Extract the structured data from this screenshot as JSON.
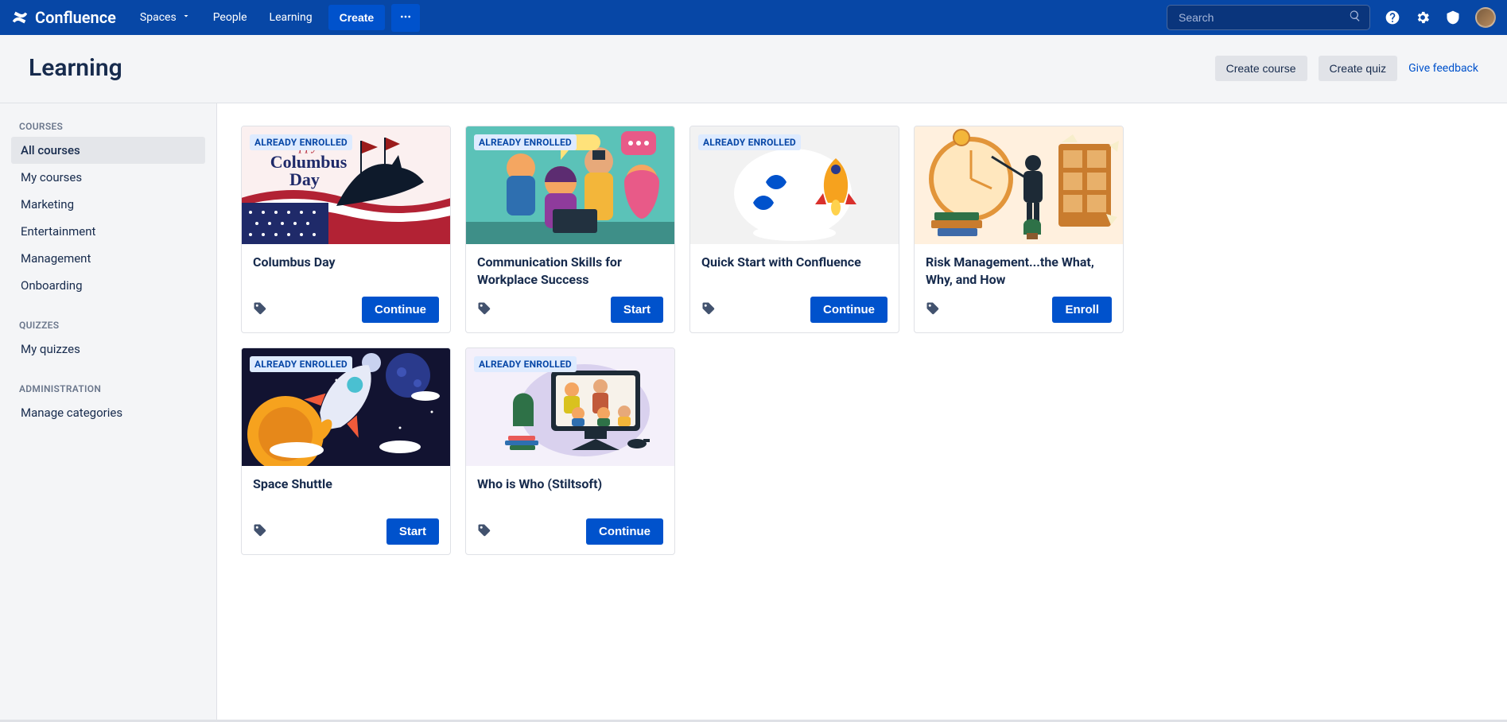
{
  "brand": "Confluence",
  "nav": {
    "spaces": "Spaces",
    "people": "People",
    "learning": "Learning",
    "create": "Create"
  },
  "search": {
    "placeholder": "Search"
  },
  "page": {
    "title": "Learning",
    "create_course": "Create course",
    "create_quiz": "Create quiz",
    "give_feedback": "Give feedback"
  },
  "sidebar": {
    "courses_h": "COURSES",
    "courses": [
      "All courses",
      "My courses",
      "Marketing",
      "Entertainment",
      "Management",
      "Onboarding"
    ],
    "quizzes_h": "QUIZZES",
    "quizzes": [
      "My quizzes"
    ],
    "admin_h": "ADMINISTRATION",
    "admin": [
      "Manage categories"
    ]
  },
  "badge_text": "ALREADY ENROLLED",
  "cards": [
    {
      "title": "Columbus Day",
      "badge": true,
      "action": "Continue",
      "bg": "#FBF0F0"
    },
    {
      "title": "Communication Skills for Workplace Success",
      "badge": true,
      "action": "Start",
      "bg": "#E8F2F2"
    },
    {
      "title": "Quick Start with Confluence",
      "badge": true,
      "action": "Continue",
      "bg": "#F2F2F2"
    },
    {
      "title": "Risk Management...the What, Why, and How",
      "badge": false,
      "action": "Enroll",
      "bg": "#FFF0DE"
    },
    {
      "title": "Space Shuttle",
      "badge": true,
      "action": "Start",
      "bg": "#121331"
    },
    {
      "title": "Who is Who (Stiltsoft)",
      "badge": true,
      "action": "Continue",
      "bg": "#F4F0FA"
    }
  ]
}
